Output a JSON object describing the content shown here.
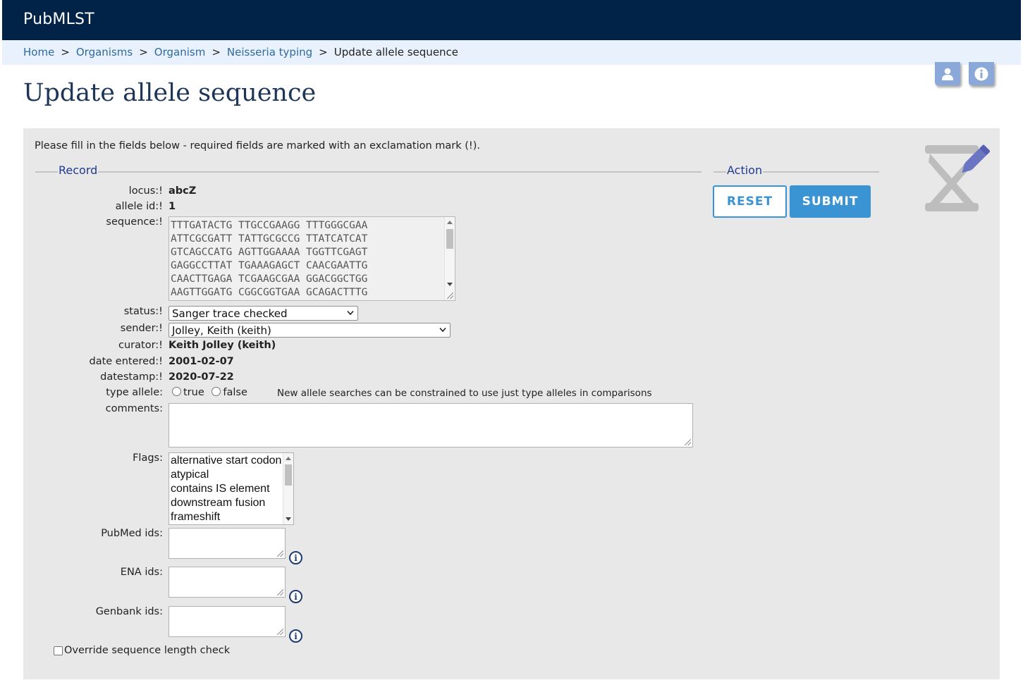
{
  "app": {
    "brand": "PubMLST"
  },
  "breadcrumb": {
    "items": [
      "Home",
      "Organisms",
      "Organism",
      "Neisseria typing"
    ],
    "separator": ">",
    "current": "Update allele sequence"
  },
  "toolbar": {
    "user_icon": "user-icon",
    "info_icon": "info-icon"
  },
  "page": {
    "title": "Update allele sequence",
    "intro": "Please fill in the fields below - required fields are marked with an exclamation mark (!)."
  },
  "record": {
    "legend": "Record",
    "locus": {
      "label": "locus:!",
      "value": "abcZ"
    },
    "allele_id": {
      "label": "allele id:!",
      "value": "1"
    },
    "sequence": {
      "label": "sequence:!",
      "lines": [
        "TTTGATACTG TTGCCGAAGG TTTGGGCGAA",
        "ATTCGCGATT TATTGCGCCG TTATCATCAT",
        "GTCAGCCATG AGTTGGAAAA TGGTTCGAGT",
        "GAGGCCTTAT TGAAAGAGCT CAACGAATTG",
        "CAACTTGAGA TCGAAGCGAA GGACGGCTGG",
        "AAGTTGGATG CGGCGGTGAA GCAGACTTTG"
      ]
    },
    "status": {
      "label": "status:!",
      "value": "Sanger trace checked"
    },
    "sender": {
      "label": "sender:!",
      "value": "Jolley, Keith (keith)"
    },
    "curator": {
      "label": "curator:!",
      "value": "Keith Jolley (keith)"
    },
    "date_entered": {
      "label": "date entered:!",
      "value": "2001-02-07"
    },
    "datestamp": {
      "label": "datestamp:!",
      "value": "2020-07-22"
    },
    "type_allele": {
      "label": "type allele:",
      "options": [
        "true",
        "false"
      ],
      "hint": "New allele searches can be constrained to use just type alleles in comparisons"
    },
    "comments": {
      "label": "comments:",
      "value": ""
    },
    "flags": {
      "label": "Flags:",
      "options": [
        "alternative start codon",
        "atypical",
        "contains IS element",
        "downstream fusion",
        "frameshift"
      ]
    },
    "pubmed": {
      "label": "PubMed ids:",
      "value": ""
    },
    "ena": {
      "label": "ENA ids:",
      "value": ""
    },
    "genbank": {
      "label": "Genbank ids:",
      "value": ""
    },
    "override": {
      "label": "Override sequence length check",
      "checked": false
    }
  },
  "action": {
    "legend": "Action",
    "reset_label": "RESET",
    "submit_label": "SUBMIT"
  },
  "colors": {
    "topbar": "#002347",
    "crumbbar": "#e8f1fc",
    "link": "#2d6aa3",
    "button": "#3a93d2",
    "panel": "#e8e8e8",
    "legend_text": "#1f3a8f"
  }
}
